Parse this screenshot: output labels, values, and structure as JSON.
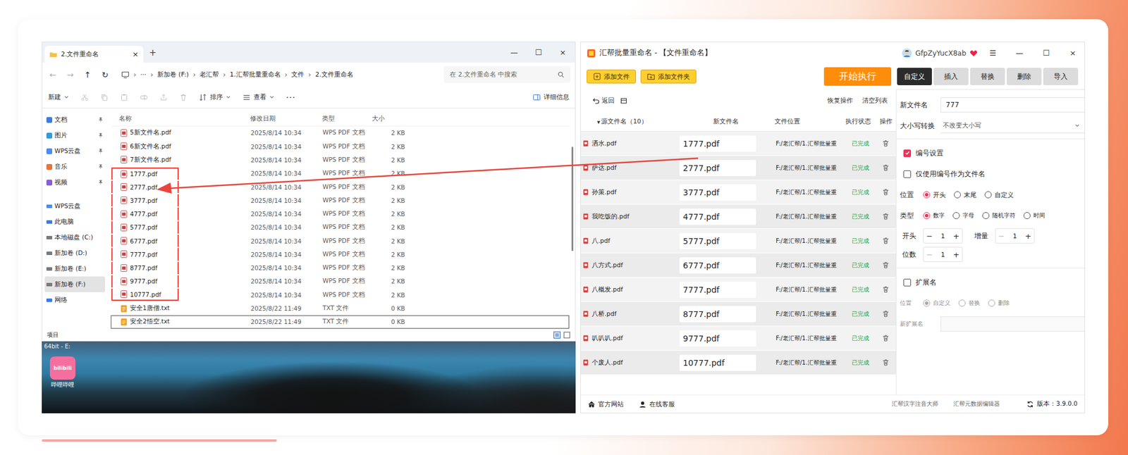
{
  "explorer": {
    "tab": {
      "title": "2.文件重命名",
      "close": "×"
    },
    "new_tab": "+",
    "window_controls": [
      "—",
      "☐",
      "×"
    ],
    "nav": [
      {
        "icon": "←",
        "disabled": true
      },
      {
        "icon": "→",
        "disabled": true
      },
      {
        "icon": "↑",
        "disabled": false
      },
      {
        "icon": "↻",
        "disabled": false
      }
    ],
    "breadcrumb_sep": "›",
    "breadcrumb_more": "···",
    "breadcrumb": [
      "新加卷 (F:)",
      "老汇帮",
      "1.汇帮批量重命名",
      "文件",
      "2.文件重命名"
    ],
    "search": {
      "placeholder": "在 2.文件重命名 中搜索"
    },
    "toolbar": [
      {
        "label": "新建",
        "dropdown": true
      },
      {
        "label": "排序",
        "dropdown": true
      },
      {
        "label": "查看",
        "dropdown": true
      },
      {
        "label": "···",
        "dropdown": false
      }
    ],
    "details": "详细信息",
    "sidebar": {
      "quick": [
        {
          "label": "文档",
          "pinned": true,
          "color": "#3b7ddd"
        },
        {
          "label": "图片",
          "pinned": true,
          "color": "#2f9be0"
        },
        {
          "label": "WPS云盘",
          "pinned": true,
          "color": "#4a8cf0"
        },
        {
          "label": "音乐",
          "pinned": true,
          "color": "#e8743b"
        },
        {
          "label": "视频",
          "pinned": true,
          "color": "#8a5cd6"
        }
      ],
      "places": [
        {
          "label": "WPS云盘",
          "selected": false,
          "color": "#4a8cf0"
        },
        {
          "label": "此电脑",
          "selected": false,
          "color": "#3b7ddd"
        },
        {
          "label": "本地磁盘 (C:)",
          "selected": false,
          "color": "#7a7a7a"
        },
        {
          "label": "新加卷 (D:)",
          "selected": false,
          "color": "#7a7a7a"
        },
        {
          "label": "新加卷 (E:)",
          "selected": false,
          "color": "#7a7a7a"
        },
        {
          "label": "新加卷 (F:)",
          "selected": true,
          "color": "#7a7a7a"
        },
        {
          "label": "网络",
          "selected": false,
          "color": "#3b7ddd"
        }
      ]
    },
    "columns": [
      "名称",
      "修改日期",
      "类型",
      "大小"
    ],
    "rows": [
      {
        "name": "5新文件名.pdf",
        "date": "2025/8/14 10:34",
        "type": "WPS PDF 文档",
        "size": "2 KB",
        "kind": "pdf",
        "highlighted": false,
        "selected": false
      },
      {
        "name": "6新文件名.pdf",
        "date": "2025/8/14 10:34",
        "type": "WPS PDF 文档",
        "size": "2 KB",
        "kind": "pdf",
        "highlighted": false,
        "selected": false
      },
      {
        "name": "7新文件名.pdf",
        "date": "2025/8/14 10:34",
        "type": "WPS PDF 文档",
        "size": "2 KB",
        "kind": "pdf",
        "highlighted": false,
        "selected": false
      },
      {
        "name": "1777.pdf",
        "date": "2025/8/14 10:34",
        "type": "WPS PDF 文档",
        "size": "2 KB",
        "kind": "pdf",
        "highlighted": true,
        "selected": false
      },
      {
        "name": "2777.pdf",
        "date": "2025/8/14 10:34",
        "type": "WPS PDF 文档",
        "size": "2 KB",
        "kind": "pdf",
        "highlighted": true,
        "selected": false
      },
      {
        "name": "3777.pdf",
        "date": "2025/8/14 10:34",
        "type": "WPS PDF 文档",
        "size": "2 KB",
        "kind": "pdf",
        "highlighted": true,
        "selected": false
      },
      {
        "name": "4777.pdf",
        "date": "2025/8/14 10:34",
        "type": "WPS PDF 文档",
        "size": "2 KB",
        "kind": "pdf",
        "highlighted": true,
        "selected": false
      },
      {
        "name": "5777.pdf",
        "date": "2025/8/14 10:34",
        "type": "WPS PDF 文档",
        "size": "2 KB",
        "kind": "pdf",
        "highlighted": true,
        "selected": false
      },
      {
        "name": "6777.pdf",
        "date": "2025/8/14 10:34",
        "type": "WPS PDF 文档",
        "size": "2 KB",
        "kind": "pdf",
        "highlighted": true,
        "selected": false
      },
      {
        "name": "7777.pdf",
        "date": "2025/8/14 10:34",
        "type": "WPS PDF 文档",
        "size": "2 KB",
        "kind": "pdf",
        "highlighted": true,
        "selected": false
      },
      {
        "name": "8777.pdf",
        "date": "2025/8/14 10:34",
        "type": "WPS PDF 文档",
        "size": "2 KB",
        "kind": "pdf",
        "highlighted": true,
        "selected": false
      },
      {
        "name": "9777.pdf",
        "date": "2025/8/14 10:34",
        "type": "WPS PDF 文档",
        "size": "2 KB",
        "kind": "pdf",
        "highlighted": true,
        "selected": false
      },
      {
        "name": "10777.pdf",
        "date": "2025/8/14 10:34",
        "type": "WPS PDF 文档",
        "size": "2 KB",
        "kind": "pdf",
        "highlighted": true,
        "selected": false
      },
      {
        "name": "安全1唐僧.txt",
        "date": "2025/8/22 11:49",
        "type": "TXT 文件",
        "size": "0 KB",
        "kind": "txt",
        "highlighted": false,
        "selected": false
      },
      {
        "name": "安全2悟空.txt",
        "date": "2025/8/22 11:49",
        "type": "TXT 文件",
        "size": "0 KB",
        "kind": "txt",
        "highlighted": false,
        "selected": true
      }
    ],
    "status": "项目"
  },
  "desktop": {
    "caption": "64bit - E:",
    "icon_logo": "bilibili",
    "icon_label": "哔哩哔哩"
  },
  "app": {
    "title": "汇帮批量重命名 - 【文件重命名】",
    "user": "GfpZyYucX8ab",
    "controls": [
      "☰",
      "—",
      "☐",
      "×"
    ],
    "add_file": "添加文件",
    "add_folder": "添加文件夹",
    "start": "开始执行",
    "tabs": [
      {
        "label": "自定义",
        "selected": true
      },
      {
        "label": "插入",
        "selected": false
      },
      {
        "label": "替换",
        "selected": false
      },
      {
        "label": "删除",
        "selected": false
      },
      {
        "label": "导入",
        "selected": false
      }
    ],
    "back": "返回",
    "restore": "恢复操作",
    "clear": "清空列表",
    "source_sort": "▾",
    "columns": [
      "源文件名（10）",
      "新文件名",
      "文件位置",
      "执行状态",
      "操作"
    ],
    "rows": [
      {
        "source": "洒水.pdf",
        "new": "1777.pdf",
        "location": "F:/老汇帮/1.汇帮批量重",
        "status": "已完成"
      },
      {
        "source": "萨达.pdf",
        "new": "2777.pdf",
        "location": "F:/老汇帮/1.汇帮批量重",
        "status": "已完成"
      },
      {
        "source": "孙策.pdf",
        "new": "3777.pdf",
        "location": "F:/老汇帮/1.汇帮批量重",
        "status": "已完成"
      },
      {
        "source": "我吃饭的.pdf",
        "new": "4777.pdf",
        "location": "F:/老汇帮/1.汇帮批量重",
        "status": "已完成"
      },
      {
        "source": "八.pdf",
        "new": "5777.pdf",
        "location": "F:/老汇帮/1.汇帮批量重",
        "status": "已完成"
      },
      {
        "source": "八方式.pdf",
        "new": "6777.pdf",
        "location": "F:/老汇帮/1.汇帮批量重",
        "status": "已完成"
      },
      {
        "source": "八概发.pdf",
        "new": "7777.pdf",
        "location": "F:/老汇帮/1.汇帮批量重",
        "status": "已完成"
      },
      {
        "source": "八桥.pdf",
        "new": "8777.pdf",
        "location": "F:/老汇帮/1.汇帮批量重",
        "status": "已完成"
      },
      {
        "source": "叭叭叭.pdf",
        "new": "9777.pdf",
        "location": "F:/老汇帮/1.汇帮批量重",
        "status": "已完成"
      },
      {
        "source": "个废人.pdf",
        "new": "10777.pdf",
        "location": "F:/老汇帮/1.汇帮批量重",
        "status": "已完成"
      }
    ],
    "settings": {
      "new_name": {
        "label": "新文件名",
        "value": "777"
      },
      "case": {
        "label": "大小写转换",
        "value": "不改变大小写"
      },
      "numbering": {
        "label": "编号设置",
        "checked": true
      },
      "only_number": {
        "label": "仅使用编号作为文件名",
        "checked": false
      },
      "position": {
        "label": "位置",
        "options": [
          {
            "label": "开头",
            "selected": true
          },
          {
            "label": "末尾",
            "selected": false
          },
          {
            "label": "自定义",
            "selected": false
          }
        ]
      },
      "type": {
        "label": "类型",
        "options": [
          {
            "label": "数字",
            "selected": true
          },
          {
            "label": "字母",
            "selected": false
          },
          {
            "label": "随机字符",
            "selected": false
          },
          {
            "label": "时间",
            "selected": false
          }
        ]
      },
      "stepper_minus": "−",
      "stepper_plus": "+",
      "steppers": [
        {
          "label": "开头",
          "value": "1",
          "minus_disabled": false
        },
        {
          "label": "增量",
          "value": "1",
          "minus_disabled": true
        },
        {
          "label": "位数",
          "value": "1",
          "minus_disabled": true
        }
      ],
      "extension": {
        "label": "扩展名",
        "checked": false
      },
      "ext_position": {
        "label": "位置",
        "disabled": true,
        "options": [
          {
            "label": "自定义",
            "selected": true
          },
          {
            "label": "替换",
            "selected": false
          },
          {
            "label": "删除",
            "selected": false
          }
        ]
      },
      "new_ext": {
        "label": "新扩展名",
        "value": ""
      }
    },
    "footer": {
      "website": "官方网站",
      "service": "在线客服",
      "links": [
        "汇帮汉字注音大师",
        "汇帮元数据编辑器"
      ],
      "version": "版本：3.9.0.0"
    }
  }
}
